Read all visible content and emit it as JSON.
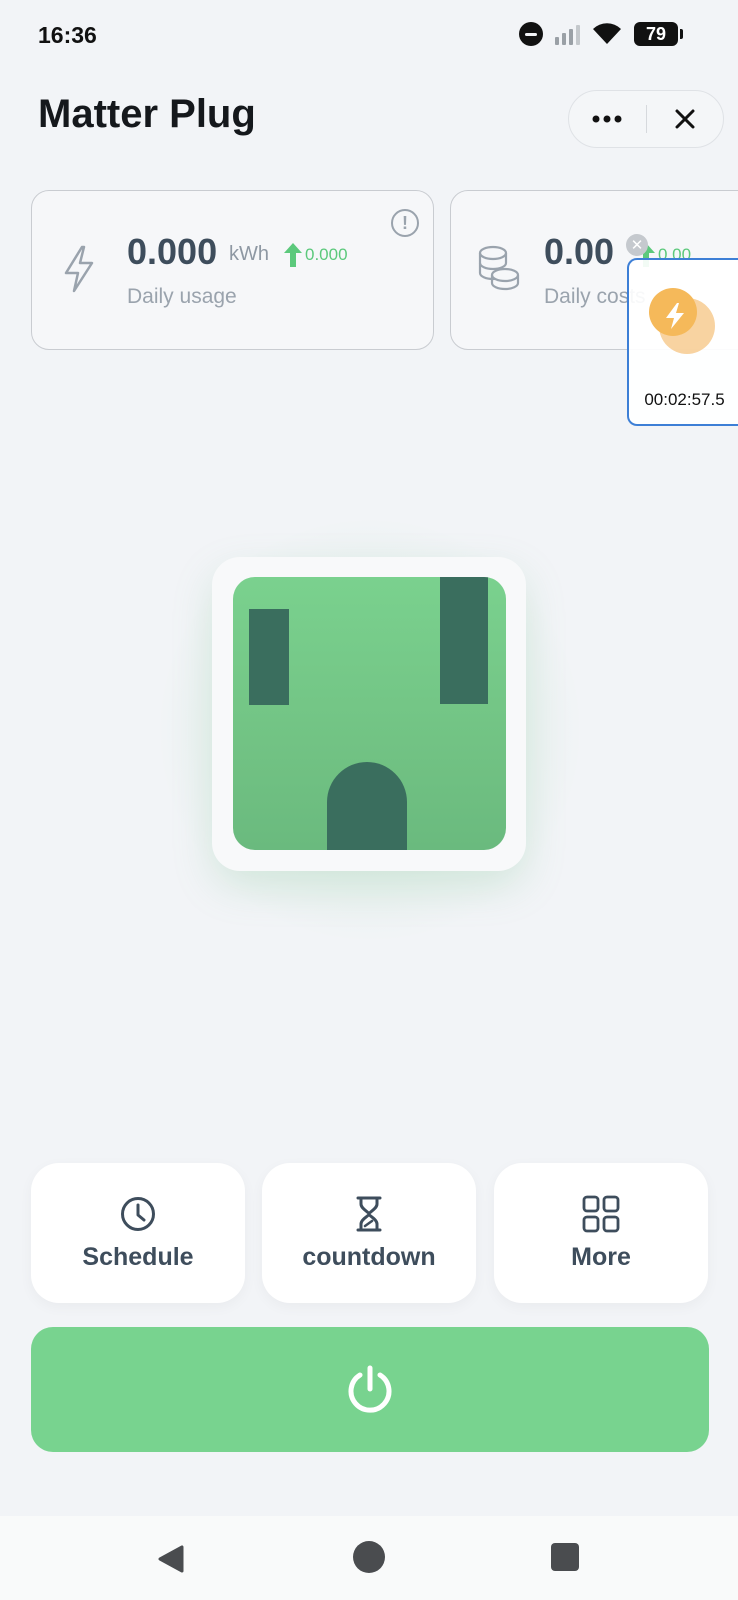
{
  "status_bar": {
    "time": "16:36",
    "battery": "79"
  },
  "header": {
    "title": "Matter Plug",
    "more_icon": "more-horizontal-icon",
    "close_icon": "close-icon"
  },
  "cards": [
    {
      "value": "0.000",
      "unit": "kWh",
      "trend": "0.000",
      "label": "Daily usage",
      "icon": "lightning-icon"
    },
    {
      "value": "0.00",
      "trend": "0.00",
      "label": "Daily costs",
      "icon": "coins-icon"
    }
  ],
  "floating_widget": {
    "time": "00:02:57.5"
  },
  "actions": [
    {
      "label": "Schedule",
      "icon": "clock-icon"
    },
    {
      "label": "countdown",
      "icon": "hourglass-icon"
    },
    {
      "label": "More",
      "icon": "grid-icon"
    }
  ],
  "power_button": {
    "icon": "power-icon"
  },
  "colors": {
    "accent_green": "#78d38f",
    "trend_green": "#5cc97c",
    "socket_slot": "#3a6e5e",
    "text_dark": "#3e4d5c"
  }
}
